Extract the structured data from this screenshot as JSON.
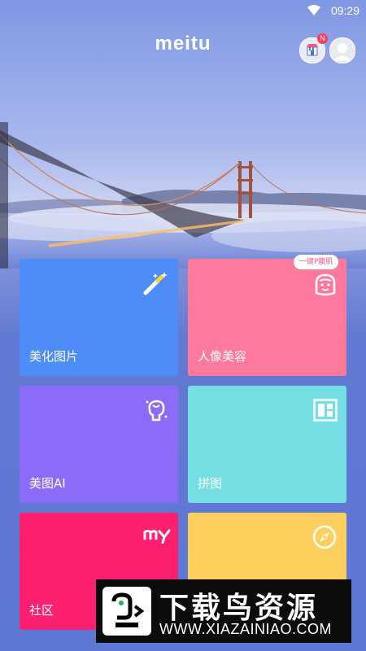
{
  "status_bar": {
    "time": "09:29",
    "wifi_icon": "wifi-icon"
  },
  "header": {
    "logo": "meitu",
    "store_badge": "N",
    "store_icon": "store-icon",
    "avatar_icon": "user-avatar-icon"
  },
  "tiles": [
    {
      "label": "美化图片",
      "icon": "magic-wand-icon",
      "color": "#4e8cf7"
    },
    {
      "label": "人像美容",
      "icon": "face-icon",
      "color": "#fd7a9c",
      "bubble": "一键P腹肌"
    },
    {
      "label": "美图AI",
      "icon": "ai-head-icon",
      "color": "#8a6cf8"
    },
    {
      "label": "拼图",
      "icon": "collage-icon",
      "color": "#73dfe3"
    },
    {
      "label": "社区",
      "icon": "community-logo-icon",
      "color": "#fd2071"
    },
    {
      "label": "",
      "icon": "compass-icon",
      "color": "#fdd05d"
    }
  ],
  "watermark": {
    "title": "下载鸟资源",
    "url": "WWW.XIAZAINIAO.COM"
  }
}
